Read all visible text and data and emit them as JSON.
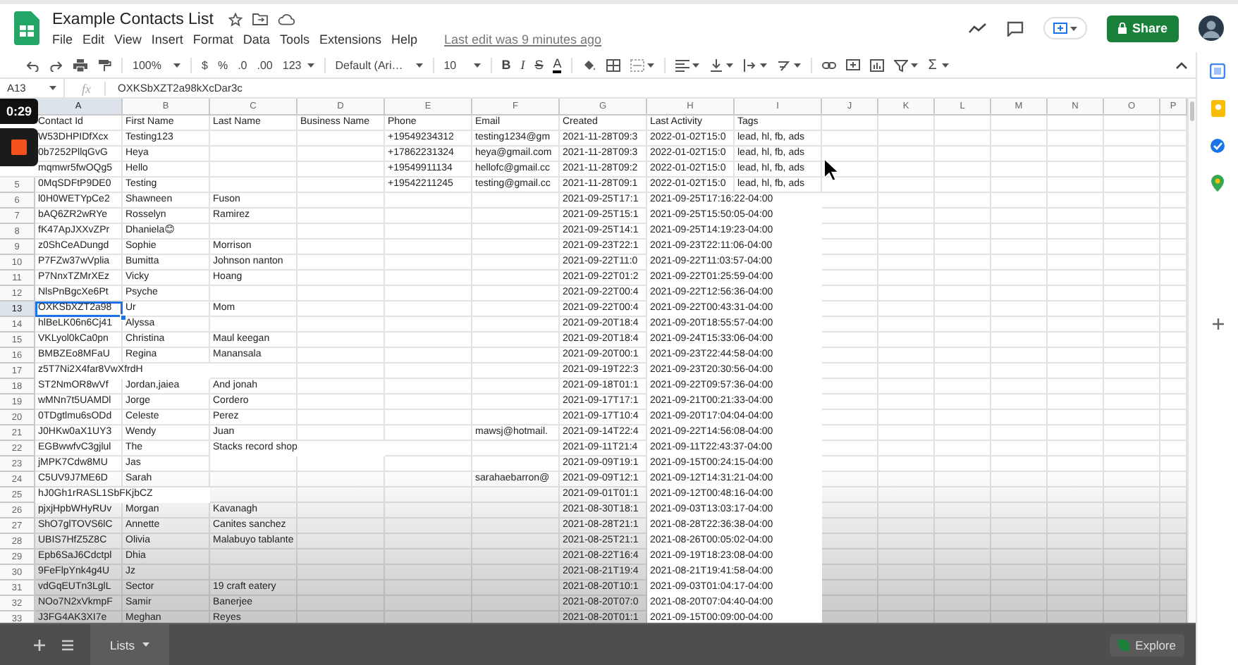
{
  "document": {
    "title": "Example Contacts List",
    "last_edit": "Last edit was 9 minutes ago"
  },
  "menu": [
    "File",
    "Edit",
    "View",
    "Insert",
    "Format",
    "Data",
    "Tools",
    "Extensions",
    "Help"
  ],
  "share_button": "Share",
  "toolbar": {
    "zoom": "100%",
    "currency": "$",
    "percent": "%",
    "decrease_decimals": ".0",
    "increase_decimals": ".00",
    "more_formats": "123",
    "font": "Default (Ari…",
    "font_size": "10",
    "bold": "B",
    "italic": "I",
    "strikethrough": "S",
    "text_color": "A",
    "functions": "Σ"
  },
  "formula_bar": {
    "name_box": "A13",
    "fx": "fx",
    "value": "OXKSbXZT2a98kXcDar3c"
  },
  "recording": {
    "timer": "0:29"
  },
  "columns": [
    {
      "label": "A",
      "selected": true
    },
    {
      "label": "B",
      "selected": false
    },
    {
      "label": "C",
      "selected": false
    },
    {
      "label": "D",
      "selected": false
    },
    {
      "label": "E",
      "selected": false
    },
    {
      "label": "F",
      "selected": false
    },
    {
      "label": "G",
      "selected": false
    },
    {
      "label": "H",
      "selected": false
    },
    {
      "label": "I",
      "selected": false
    },
    {
      "label": "J",
      "selected": false
    },
    {
      "label": "K",
      "selected": false
    },
    {
      "label": "L",
      "selected": false
    },
    {
      "label": "M",
      "selected": false
    },
    {
      "label": "N",
      "selected": false
    },
    {
      "label": "O",
      "selected": false
    },
    {
      "label": "P",
      "selected": false
    }
  ],
  "rows": [
    {
      "selected": false,
      "contact_id": "Contact Id",
      "first_name": "First Name",
      "last_name": "Last Name",
      "business_name": "Business Name",
      "phone": "Phone",
      "email": "Email",
      "created": "Created",
      "last_activity": "Last Activity",
      "tags": "Tags"
    },
    {
      "selected": false,
      "contact_id": "W53DHPIDfXcx",
      "first_name": "Testing123",
      "phone": "+19549234312",
      "email": "testing1234@gm",
      "created": "2021-11-28T09:3",
      "last_activity": "2022-01-02T15:0",
      "tags": "lead, hl, fb, ads"
    },
    {
      "selected": false,
      "contact_id": "0b7252PllqGvG",
      "first_name": "Heya",
      "phone": "+17862231324",
      "email": "heya@gmail.com",
      "created": "2021-11-28T09:3",
      "last_activity": "2022-01-02T15:0",
      "tags": "lead, hl, fb, ads"
    },
    {
      "selected": false,
      "contact_id": "mqmwr5fwOQg5",
      "first_name": "Hello",
      "phone": "+19549911134",
      "email": "hellofc@gmail.cc",
      "created": "2021-11-28T09:2",
      "last_activity": "2022-01-02T15:0",
      "tags": "lead, hl, fb, ads"
    },
    {
      "n": "5",
      "selected": false,
      "contact_id": "0MqSDFtP9DE0",
      "first_name": "Testing",
      "phone": "+19542211245",
      "email": "testing@gmail.cc",
      "created": "2021-11-28T09:1",
      "last_activity": "2022-01-02T15:0",
      "tags": "lead, hl, fb, ads"
    },
    {
      "n": "6",
      "selected": false,
      "contact_id": "l0H0WETYpCe2",
      "first_name": "Shawneen",
      "last_name": "Fuson",
      "created": "2021-09-25T17:1",
      "last_activity": "2021-09-25T17:16:22-04:00"
    },
    {
      "n": "7",
      "selected": false,
      "contact_id": "bAQ6ZR2wRYe",
      "first_name": "Rosselyn",
      "last_name": "Ramirez",
      "created": "2021-09-25T15:1",
      "last_activity": "2021-09-25T15:50:05-04:00"
    },
    {
      "n": "8",
      "selected": false,
      "contact_id": "fK47ApJXXvZPr",
      "first_name": "Dhaniela😊",
      "created": "2021-09-25T14:1",
      "last_activity": "2021-09-25T14:19:23-04:00"
    },
    {
      "n": "9",
      "selected": false,
      "contact_id": "z0ShCeADungd",
      "first_name": "Sophie",
      "last_name": "Morrison",
      "created": "2021-09-23T22:1",
      "last_activity": "2021-09-23T22:11:06-04:00"
    },
    {
      "n": "10",
      "selected": false,
      "contact_id": "P7FZw37wVplia",
      "first_name": "Bumitta",
      "last_name": "Johnson nanton",
      "created": "2021-09-22T11:0",
      "last_activity": "2021-09-22T11:03:57-04:00"
    },
    {
      "n": "11",
      "selected": false,
      "contact_id": "P7NnxTZMrXEz",
      "first_name": "Vicky",
      "last_name": "Hoang",
      "created": "2021-09-22T01:2",
      "last_activity": "2021-09-22T01:25:59-04:00"
    },
    {
      "n": "12",
      "selected": false,
      "contact_id": "NlsPnBgcXe6Pt",
      "first_name": "Psyche",
      "created": "2021-09-22T00:4",
      "last_activity": "2021-09-22T12:56:36-04:00"
    },
    {
      "n": "13",
      "selected": true,
      "contact_id": "OXKSbXZT2a98",
      "first_name": "Ur",
      "last_name": "Mom",
      "created": "2021-09-22T00:4",
      "last_activity": "2021-09-22T00:43:31-04:00"
    },
    {
      "n": "14",
      "selected": false,
      "contact_id": "hlBeLK06n6Cj41",
      "first_name": "Alyssa",
      "created": "2021-09-20T18:4",
      "last_activity": "2021-09-20T18:55:57-04:00"
    },
    {
      "n": "15",
      "selected": false,
      "contact_id": "VKLyol0kCa0pn",
      "first_name": "Christina",
      "last_name": "Maul keegan",
      "created": "2021-09-20T18:4",
      "last_activity": "2021-09-24T15:33:06-04:00"
    },
    {
      "n": "16",
      "selected": false,
      "contact_id": "BMBZEo8MFaU",
      "first_name": "Regina",
      "last_name": "Manansala",
      "created": "2021-09-20T00:1",
      "last_activity": "2021-09-23T22:44:58-04:00"
    },
    {
      "n": "17",
      "selected": false,
      "contact_id": "z5T7Ni2X4far8VwXfrdH",
      "created": "2021-09-19T22:3",
      "last_activity": "2021-09-23T20:30:56-04:00"
    },
    {
      "n": "18",
      "selected": false,
      "contact_id": "ST2NmOR8wVf",
      "first_name": "Jordan,jaiea",
      "last_name": "And jonah",
      "created": "2021-09-18T01:1",
      "last_activity": "2021-09-22T09:57:36-04:00"
    },
    {
      "n": "19",
      "selected": false,
      "contact_id": "wMNn7t5UAMDl",
      "first_name": "Jorge",
      "last_name": "Cordero",
      "created": "2021-09-17T17:1",
      "last_activity": "2021-09-21T00:21:33-04:00"
    },
    {
      "n": "20",
      "selected": false,
      "contact_id": "0TDgtlmu6sODd",
      "first_name": "Celeste",
      "last_name": "Perez",
      "created": "2021-09-17T10:4",
      "last_activity": "2021-09-20T17:04:04-04:00"
    },
    {
      "n": "21",
      "selected": false,
      "contact_id": "J0HKw0aX1UY3",
      "first_name": "Wendy",
      "last_name": "Juan",
      "email": "mawsj@hotmail.",
      "created": "2021-09-14T22:4",
      "last_activity": "2021-09-22T14:56:08-04:00"
    },
    {
      "n": "22",
      "selected": false,
      "contact_id": "EGBwwfvC3gjlul",
      "first_name": "The",
      "last_name": "Stacks record shop",
      "created": "2021-09-11T21:4",
      "last_activity": "2021-09-11T22:43:37-04:00"
    },
    {
      "n": "23",
      "selected": false,
      "contact_id": "jMPK7Cdw8MU",
      "first_name": "Jas",
      "created": "2021-09-09T19:1",
      "last_activity": "2021-09-15T00:24:15-04:00"
    },
    {
      "n": "24",
      "selected": false,
      "contact_id": "C5UV9J7ME6D",
      "first_name": "Sarah",
      "email": "sarahaebarron@",
      "created": "2021-09-09T12:1",
      "last_activity": "2021-09-12T14:31:21-04:00"
    },
    {
      "n": "25",
      "selected": false,
      "contact_id": "hJ0Gh1rRASL1SbFKjbCZ",
      "created": "2021-09-01T01:1",
      "last_activity": "2021-09-12T00:48:16-04:00"
    },
    {
      "n": "26",
      "selected": false,
      "contact_id": "pjxjHpbWHyRUv",
      "first_name": "Morgan",
      "last_name": "Kavanagh",
      "created": "2021-08-30T18:1",
      "last_activity": "2021-09-03T13:03:17-04:00"
    },
    {
      "n": "27",
      "selected": false,
      "contact_id": "ShO7glTOVS6lC",
      "first_name": "Annette",
      "last_name": "Canites sanchez",
      "created": "2021-08-28T21:1",
      "last_activity": "2021-08-28T22:36:38-04:00"
    },
    {
      "n": "28",
      "selected": false,
      "contact_id": "UBIS7HfZ5Z8C",
      "first_name": "Olivia",
      "last_name": "Malabuyo tablante",
      "created": "2021-08-25T21:1",
      "last_activity": "2021-08-26T00:05:02-04:00"
    },
    {
      "n": "29",
      "selected": false,
      "contact_id": "Epb6SaJ6Cdctpl",
      "first_name": "Dhia",
      "created": "2021-08-22T16:4",
      "last_activity": "2021-09-19T18:23:08-04:00"
    },
    {
      "n": "30",
      "selected": false,
      "contact_id": "9FeFlpYnk4g4U",
      "first_name": "Jz",
      "created": "2021-08-21T19:4",
      "last_activity": "2021-08-21T19:41:58-04:00"
    },
    {
      "n": "31",
      "selected": false,
      "contact_id": "vdGqEUTn3LglL",
      "first_name": "Sector",
      "last_name": "19 craft eatery",
      "created": "2021-08-20T10:1",
      "last_activity": "2021-09-03T01:04:17-04:00"
    },
    {
      "n": "32",
      "selected": false,
      "contact_id": "NOo7N2xVkmpF",
      "first_name": "Samir",
      "last_name": "Banerjee",
      "created": "2021-08-20T07:0",
      "last_activity": "2021-08-20T07:04:40-04:00"
    },
    {
      "n": "33",
      "selected": false,
      "contact_id": "J3FG4AK3XI7e",
      "first_name": "Meghan",
      "last_name": "Reyes",
      "created": "2021-08-20T01:1",
      "last_activity": "2021-09-15T00:09:00-04:00"
    }
  ],
  "sheet_tabs": [
    {
      "label": "Lists",
      "selected": true
    }
  ],
  "explore_button": "Explore"
}
